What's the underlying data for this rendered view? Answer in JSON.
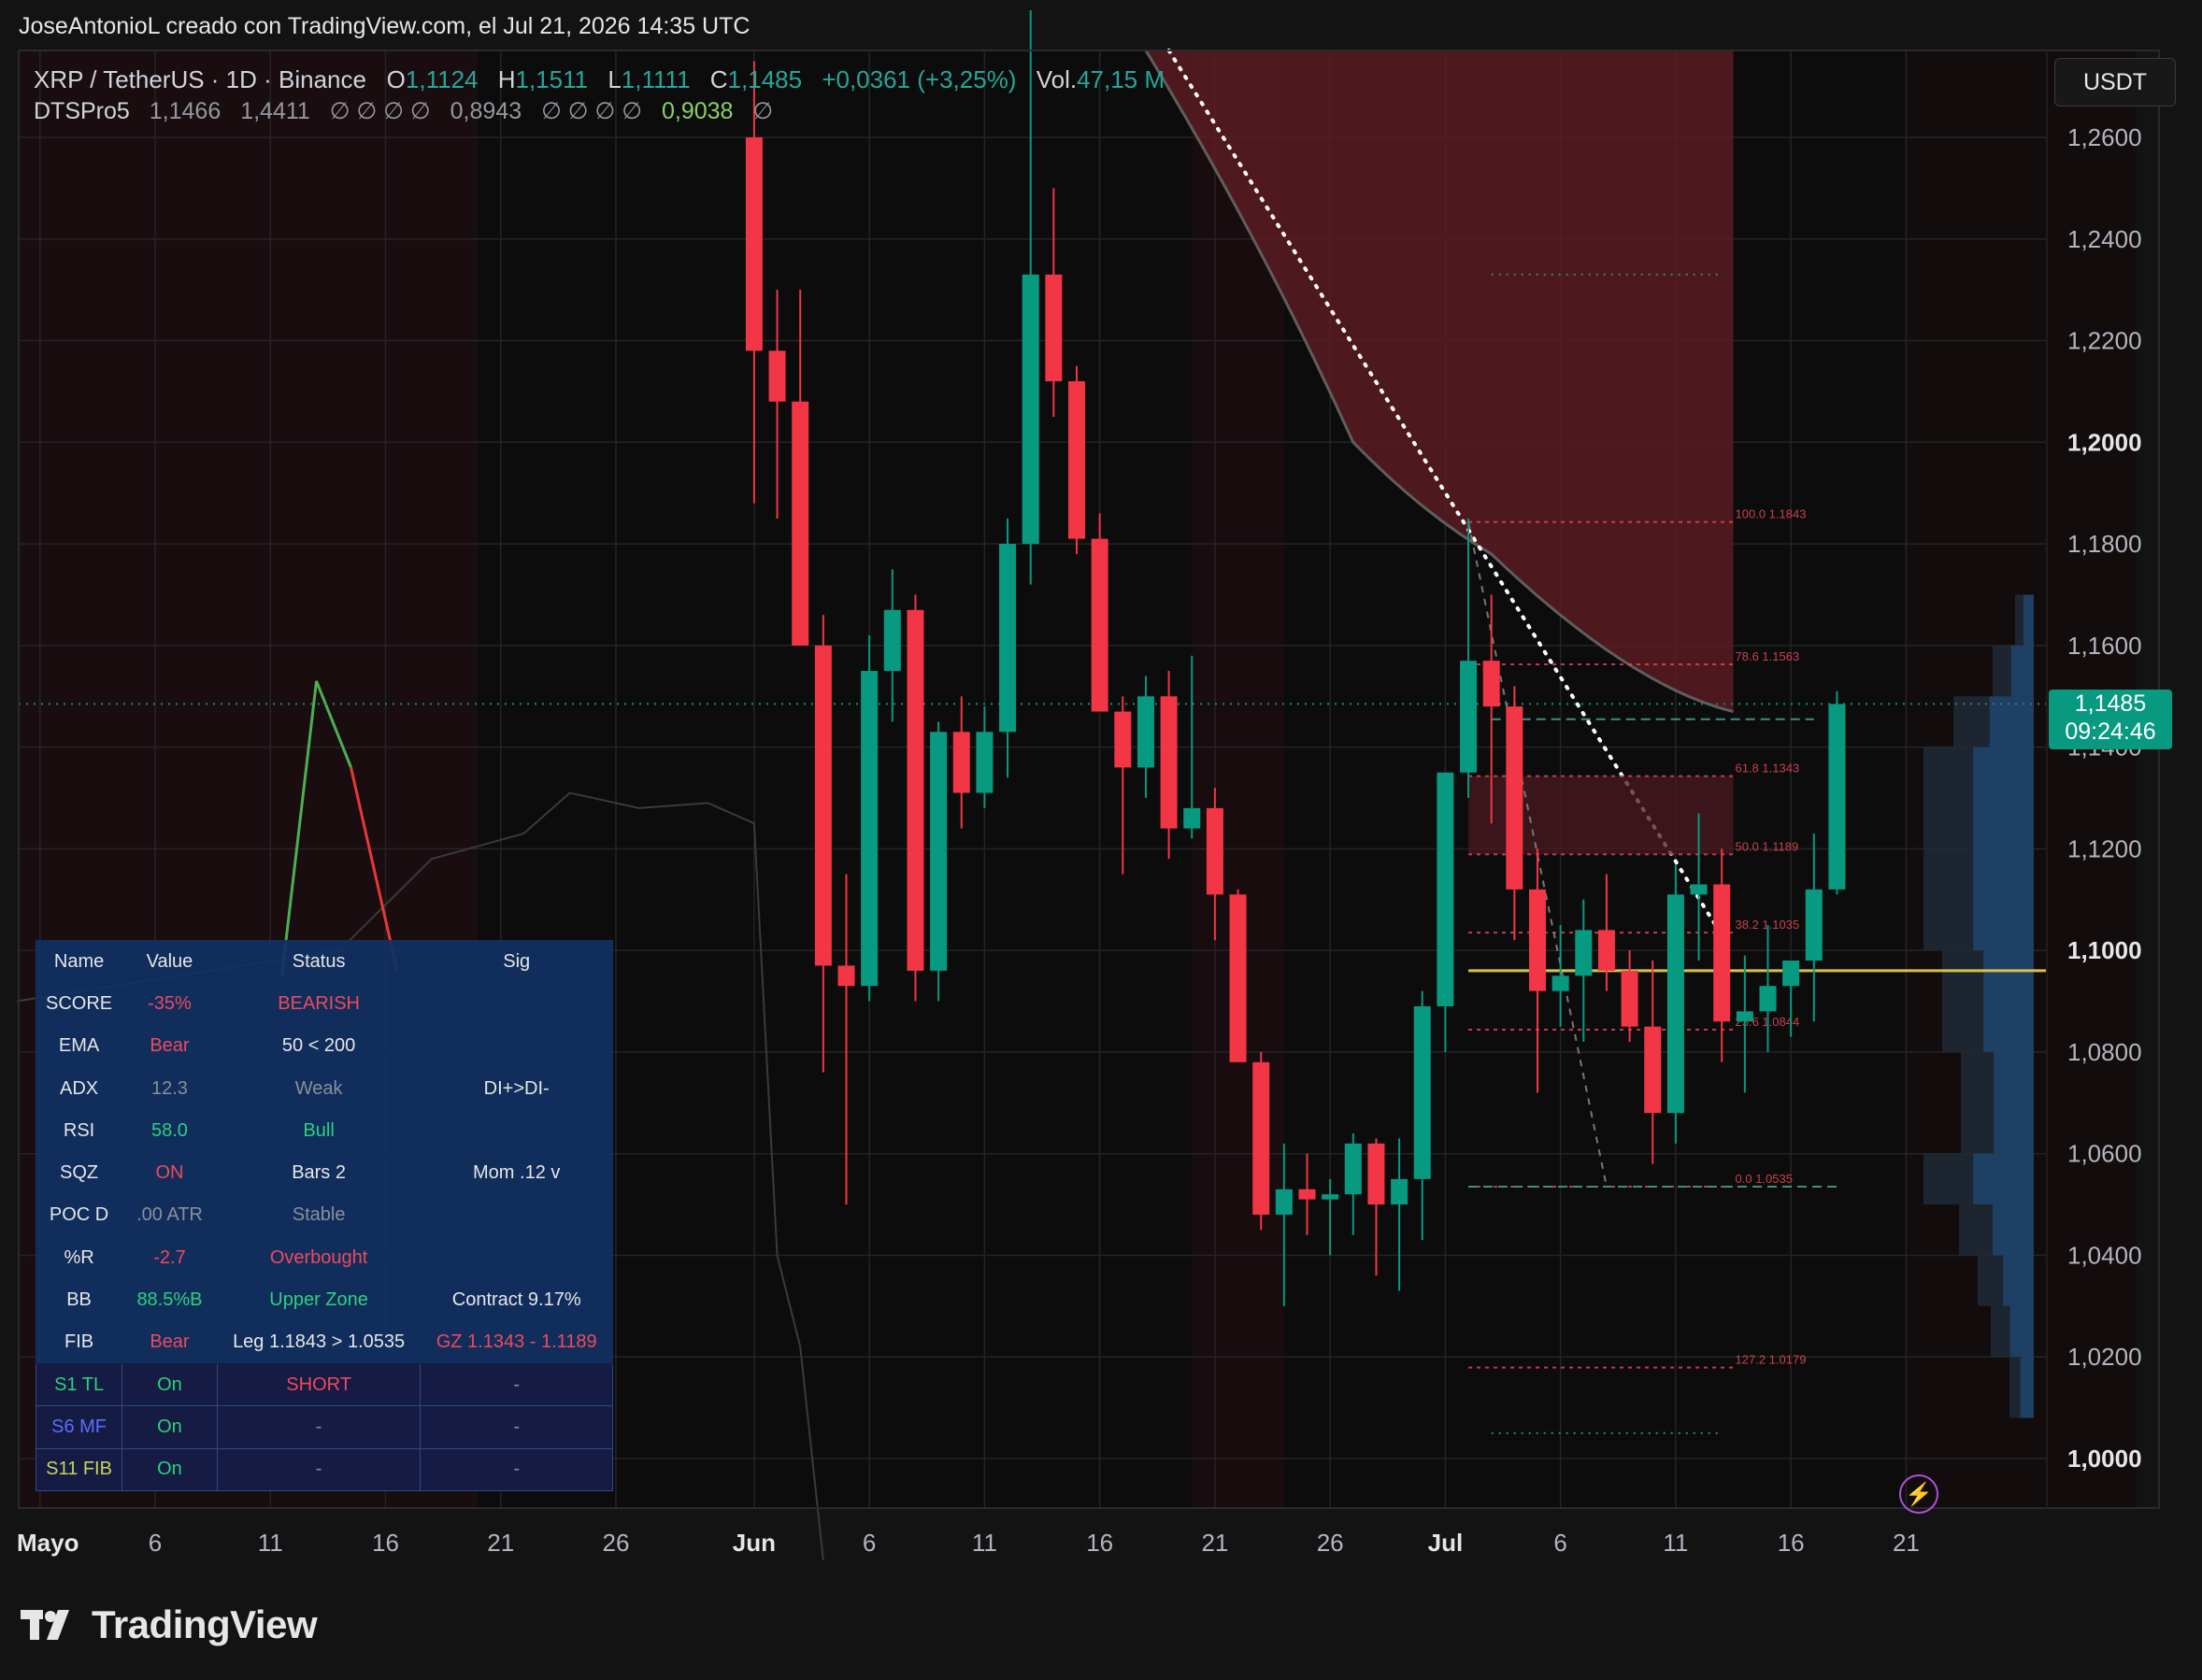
{
  "header": {
    "attribution": "JoseAntonioL creado con TradingView.com, el Jul 21, 2026 14:35 UTC"
  },
  "legend": {
    "symbol": "XRP / TetherUS · 1D · Binance",
    "o_label": "O",
    "o_value": "1,1124",
    "h_label": "H",
    "h_value": "1,1511",
    "l_label": "L",
    "l_value": "1,1111",
    "c_label": "C",
    "c_value": "1,1485",
    "change": "+0,0361 (+3,25%)",
    "vol_label": "Vol.",
    "vol_value": "47,15 M",
    "indicator": "DTSPro5",
    "ind_v1": "1,1466",
    "ind_v2": "1,4411",
    "ind_na1": "∅ ∅ ∅ ∅",
    "ind_v3": "0,8943",
    "ind_na2": "∅ ∅ ∅ ∅",
    "ind_v4": "0,9038",
    "ind_na3": "∅"
  },
  "currency_button": "USDT",
  "price_tag": {
    "price": "1,1485",
    "countdown": "09:24:46"
  },
  "brand": "TradingView",
  "colors": {
    "up": "#089981",
    "down": "#f23645",
    "bg": "#131313",
    "grid": "#242424",
    "fib": "#e04555",
    "poc": "#d4c24a",
    "band": "#5a1c22",
    "profile": "#1d3a5a"
  },
  "table": {
    "headers": [
      "Name",
      "Value",
      "Status",
      "Sig"
    ],
    "rows": [
      [
        "SCORE",
        "-35%",
        "BEARISH",
        ""
      ],
      [
        "EMA",
        "Bear",
        "50 < 200",
        ""
      ],
      [
        "ADX",
        "12.3",
        "Weak",
        "DI+>DI-"
      ],
      [
        "RSI",
        "58.0",
        "Bull",
        ""
      ],
      [
        "SQZ",
        "ON",
        "Bars 2",
        "Mom .12 v"
      ],
      [
        "POC D",
        ".00 ATR",
        "Stable",
        ""
      ],
      [
        "%R",
        "-2.7",
        "Overbought",
        ""
      ],
      [
        "BB",
        "88.5%B",
        "Upper Zone",
        "Contract 9.17%"
      ],
      [
        "FIB",
        "Bear",
        "Leg 1.1843 > 1.0535",
        "GZ 1.1343 - 1.1189"
      ],
      [
        "S1 TL",
        "On",
        "SHORT",
        "-"
      ],
      [
        "S6 MF",
        "On",
        "-",
        "-"
      ],
      [
        "S11 FIB",
        "On",
        "-",
        "-"
      ]
    ]
  },
  "chart_data": {
    "type": "candlestick",
    "symbol": "XRP / TetherUS",
    "timeframe": "1D",
    "exchange": "Binance",
    "y_axis": {
      "ticks": [
        "1,2600",
        "1,2400",
        "1,2200",
        "1,2000",
        "1,1800",
        "1,1600",
        "1,1400",
        "1,1200",
        "1,1000",
        "1,0800",
        "1,0600",
        "1,0400",
        "1,0200",
        "1,0000"
      ],
      "range": [
        0.99,
        1.275
      ]
    },
    "x_axis": {
      "ticks": [
        "Mayo",
        "6",
        "11",
        "16",
        "21",
        "26",
        "Jun",
        "6",
        "11",
        "16",
        "21",
        "26",
        "Jul",
        "6",
        "11",
        "16",
        "21"
      ]
    },
    "candles": [
      {
        "date": "Jun 1",
        "o": 1.26,
        "h": 1.275,
        "l": 1.188,
        "c": 1.218
      },
      {
        "date": "Jun 2",
        "o": 1.218,
        "h": 1.23,
        "l": 1.185,
        "c": 1.208
      },
      {
        "date": "Jun 3",
        "o": 1.208,
        "h": 1.23,
        "l": 1.18,
        "c": 1.16
      },
      {
        "date": "Jun 4",
        "o": 1.16,
        "h": 1.166,
        "l": 1.076,
        "c": 1.097
      },
      {
        "date": "Jun 5",
        "o": 1.097,
        "h": 1.115,
        "l": 1.05,
        "c": 1.093
      },
      {
        "date": "Jun 6",
        "o": 1.093,
        "h": 1.162,
        "l": 1.09,
        "c": 1.155
      },
      {
        "date": "Jun 7",
        "o": 1.155,
        "h": 1.175,
        "l": 1.145,
        "c": 1.167
      },
      {
        "date": "Jun 8",
        "o": 1.167,
        "h": 1.17,
        "l": 1.09,
        "c": 1.096
      },
      {
        "date": "Jun 9",
        "o": 1.096,
        "h": 1.145,
        "l": 1.09,
        "c": 1.143
      },
      {
        "date": "Jun 10",
        "o": 1.143,
        "h": 1.15,
        "l": 1.124,
        "c": 1.131
      },
      {
        "date": "Jun 11",
        "o": 1.131,
        "h": 1.148,
        "l": 1.128,
        "c": 1.143
      },
      {
        "date": "Jun 12",
        "o": 1.143,
        "h": 1.185,
        "l": 1.134,
        "c": 1.18
      },
      {
        "date": "Jun 13",
        "o": 1.18,
        "h": 1.285,
        "l": 1.172,
        "c": 1.233
      },
      {
        "date": "Jun 14",
        "o": 1.233,
        "h": 1.25,
        "l": 1.205,
        "c": 1.212
      },
      {
        "date": "Jun 15",
        "o": 1.212,
        "h": 1.215,
        "l": 1.178,
        "c": 1.181
      },
      {
        "date": "Jun 16",
        "o": 1.181,
        "h": 1.186,
        "l": 1.152,
        "c": 1.147
      },
      {
        "date": "Jun 17",
        "o": 1.147,
        "h": 1.15,
        "l": 1.115,
        "c": 1.136
      },
      {
        "date": "Jun 18",
        "o": 1.136,
        "h": 1.154,
        "l": 1.13,
        "c": 1.15
      },
      {
        "date": "Jun 19",
        "o": 1.15,
        "h": 1.155,
        "l": 1.118,
        "c": 1.124
      },
      {
        "date": "Jun 20",
        "o": 1.124,
        "h": 1.158,
        "l": 1.122,
        "c": 1.128
      },
      {
        "date": "Jun 21",
        "o": 1.128,
        "h": 1.132,
        "l": 1.102,
        "c": 1.111
      },
      {
        "date": "Jun 22",
        "o": 1.111,
        "h": 1.112,
        "l": 1.085,
        "c": 1.078
      },
      {
        "date": "Jun 23",
        "o": 1.078,
        "h": 1.08,
        "l": 1.045,
        "c": 1.048
      },
      {
        "date": "Jun 24",
        "o": 1.048,
        "h": 1.062,
        "l": 1.03,
        "c": 1.053
      },
      {
        "date": "Jun 25",
        "o": 1.053,
        "h": 1.06,
        "l": 1.044,
        "c": 1.051
      },
      {
        "date": "Jun 26",
        "o": 1.051,
        "h": 1.055,
        "l": 1.04,
        "c": 1.052
      },
      {
        "date": "Jun 27",
        "o": 1.052,
        "h": 1.064,
        "l": 1.044,
        "c": 1.062
      },
      {
        "date": "Jun 28",
        "o": 1.062,
        "h": 1.063,
        "l": 1.036,
        "c": 1.05
      },
      {
        "date": "Jun 29",
        "o": 1.05,
        "h": 1.063,
        "l": 1.033,
        "c": 1.055
      },
      {
        "date": "Jun 30",
        "o": 1.055,
        "h": 1.092,
        "l": 1.043,
        "c": 1.089
      },
      {
        "date": "Jul 1",
        "o": 1.089,
        "h": 1.115,
        "l": 1.08,
        "c": 1.135
      },
      {
        "date": "Jul 2",
        "o": 1.135,
        "h": 1.185,
        "l": 1.13,
        "c": 1.157
      },
      {
        "date": "Jul 3",
        "o": 1.157,
        "h": 1.17,
        "l": 1.125,
        "c": 1.148
      },
      {
        "date": "Jul 4",
        "o": 1.148,
        "h": 1.152,
        "l": 1.102,
        "c": 1.112
      },
      {
        "date": "Jul 5",
        "o": 1.112,
        "h": 1.12,
        "l": 1.072,
        "c": 1.092
      },
      {
        "date": "Jul 6",
        "o": 1.092,
        "h": 1.105,
        "l": 1.085,
        "c": 1.095
      },
      {
        "date": "Jul 7",
        "o": 1.095,
        "h": 1.11,
        "l": 1.082,
        "c": 1.104
      },
      {
        "date": "Jul 8",
        "o": 1.104,
        "h": 1.115,
        "l": 1.092,
        "c": 1.096
      },
      {
        "date": "Jul 9",
        "o": 1.096,
        "h": 1.1,
        "l": 1.082,
        "c": 1.085
      },
      {
        "date": "Jul 10",
        "o": 1.085,
        "h": 1.098,
        "l": 1.058,
        "c": 1.068
      },
      {
        "date": "Jul 11",
        "o": 1.068,
        "h": 1.117,
        "l": 1.062,
        "c": 1.111
      },
      {
        "date": "Jul 12",
        "o": 1.111,
        "h": 1.127,
        "l": 1.098,
        "c": 1.113
      },
      {
        "date": "Jul 13",
        "o": 1.113,
        "h": 1.12,
        "l": 1.078,
        "c": 1.086
      },
      {
        "date": "Jul 14",
        "o": 1.086,
        "h": 1.099,
        "l": 1.072,
        "c": 1.088
      },
      {
        "date": "Jul 15",
        "o": 1.088,
        "h": 1.105,
        "l": 1.08,
        "c": 1.093
      },
      {
        "date": "Jul 16",
        "o": 1.093,
        "h": 1.098,
        "l": 1.083,
        "c": 1.098
      },
      {
        "date": "Jul 17",
        "o": 1.098,
        "h": 1.123,
        "l": 1.086,
        "c": 1.112
      },
      {
        "date": "Jul 18",
        "o": 1.112,
        "h": 1.151,
        "l": 1.111,
        "c": 1.1485
      }
    ],
    "fib_levels": [
      {
        "label": "100.0  1.1843",
        "value": 1.1843
      },
      {
        "label": "78.6  1.1563",
        "value": 1.1563
      },
      {
        "label": "61.8  1.1343",
        "value": 1.1343
      },
      {
        "label": "50.0  1.1189",
        "value": 1.1189
      },
      {
        "label": "38.2  1.1035",
        "value": 1.1035
      },
      {
        "label": "23.6  1.0844",
        "value": 1.0844
      },
      {
        "label": "0.0  1.0535",
        "value": 1.0535
      },
      {
        "label": "127.2  1.0179",
        "value": 1.0179
      }
    ],
    "poc_level": 1.096,
    "current_price": 1.1485
  }
}
